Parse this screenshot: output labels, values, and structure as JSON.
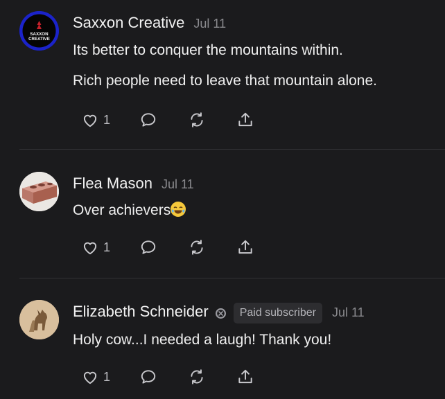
{
  "comments": [
    {
      "author": "Saxxon Creative",
      "date": "Jul 11",
      "avatar_text": "SAXXON CREATIVE",
      "lines": [
        "Its better to conquer the mountains within.",
        "Rich people need to leave that mountain alone."
      ],
      "likes": "1"
    },
    {
      "author": "Flea Mason",
      "date": "Jul 11",
      "lines": [
        "Over achievers"
      ],
      "emoji": "joy-emoji",
      "likes": "1"
    },
    {
      "author": "Elizabeth Schneider",
      "date": "Jul 11",
      "badge": "Paid subscriber",
      "lines": [
        "Holy cow...I needed a laugh! Thank you!"
      ],
      "likes": "1"
    }
  ],
  "icons": [
    "heart-icon",
    "reply-icon",
    "restack-icon",
    "share-icon",
    "subscriber-badge-icon"
  ],
  "colors": {
    "background": "#1b1b1d",
    "text": "#ececec",
    "muted": "#8a8a8e",
    "badge_bg": "#2d2d30",
    "avatar_ring": "#1b23c9"
  }
}
